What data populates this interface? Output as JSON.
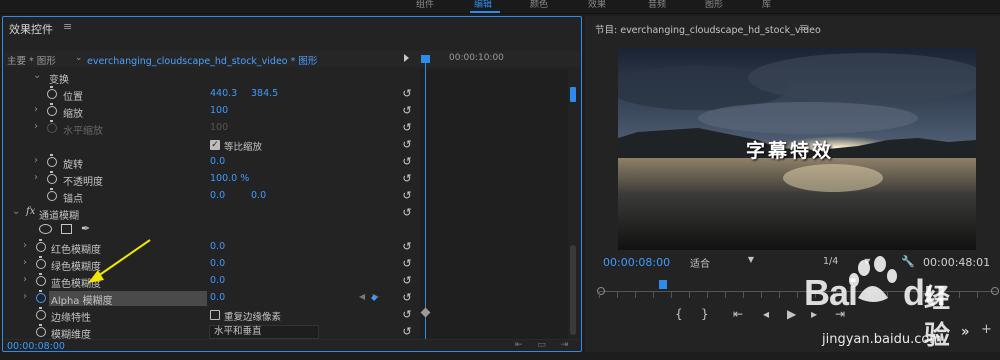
{
  "workspace": {
    "tabs": [
      "组件",
      "编辑",
      "颜色",
      "效果",
      "音频",
      "图形",
      "库"
    ],
    "active_index": 1
  },
  "effect_controls": {
    "title": "效果控件",
    "menu_icon": "hamburger-icon",
    "source_main": "主要 * 图形",
    "source_clip": "everchanging_cloudscape_hd_stock_video * 图形",
    "timeline_time": "00:00:10:00",
    "footer_time": "00:00:08:00",
    "rows": {
      "transform": "变换",
      "position": {
        "label": "位置",
        "x": "440.3",
        "y": "384.5"
      },
      "scale": {
        "label": "缩放",
        "value": "100"
      },
      "scale_width": {
        "label": "水平缩放",
        "value": "100"
      },
      "uniform_scale": "等比缩放",
      "rotation": {
        "label": "旋转",
        "value": "0.0"
      },
      "opacity": {
        "label": "不透明度",
        "value": "100.0 %"
      },
      "anchor": {
        "label": "锚点",
        "x": "0.0",
        "y": "0.0"
      },
      "channel_blur": {
        "fx": "fx",
        "label": "通道模糊"
      },
      "red_blur": {
        "label": "红色模糊度",
        "value": "0.0"
      },
      "green_blur": {
        "label": "绿色模糊度",
        "value": "0.0"
      },
      "blue_blur": {
        "label": "蓝色模糊度",
        "value": "0.0"
      },
      "alpha_blur": {
        "label": "Alpha 模糊度",
        "value": "0.0"
      },
      "edge_behavior": {
        "label": "边缘特性",
        "checkbox": "重复边缘像素"
      },
      "blur_dimensions": {
        "label": "模糊维度",
        "value": "水平和垂直"
      }
    }
  },
  "program_monitor": {
    "title": "节目: everchanging_cloudscape_hd_stock_video",
    "caption": "字幕特效",
    "current_time": "00:00:08:00",
    "fit": "适合",
    "resolution": "1/4",
    "duration": "00:00:48:01"
  },
  "watermark": {
    "brand": "Bai",
    "brand2": "du",
    "cn": "经验",
    "url": "jingyan.baidu.com"
  },
  "colors": {
    "accent": "#2d8ceb",
    "value_blue": "#3d9bff",
    "arrow": "#f2e600"
  }
}
